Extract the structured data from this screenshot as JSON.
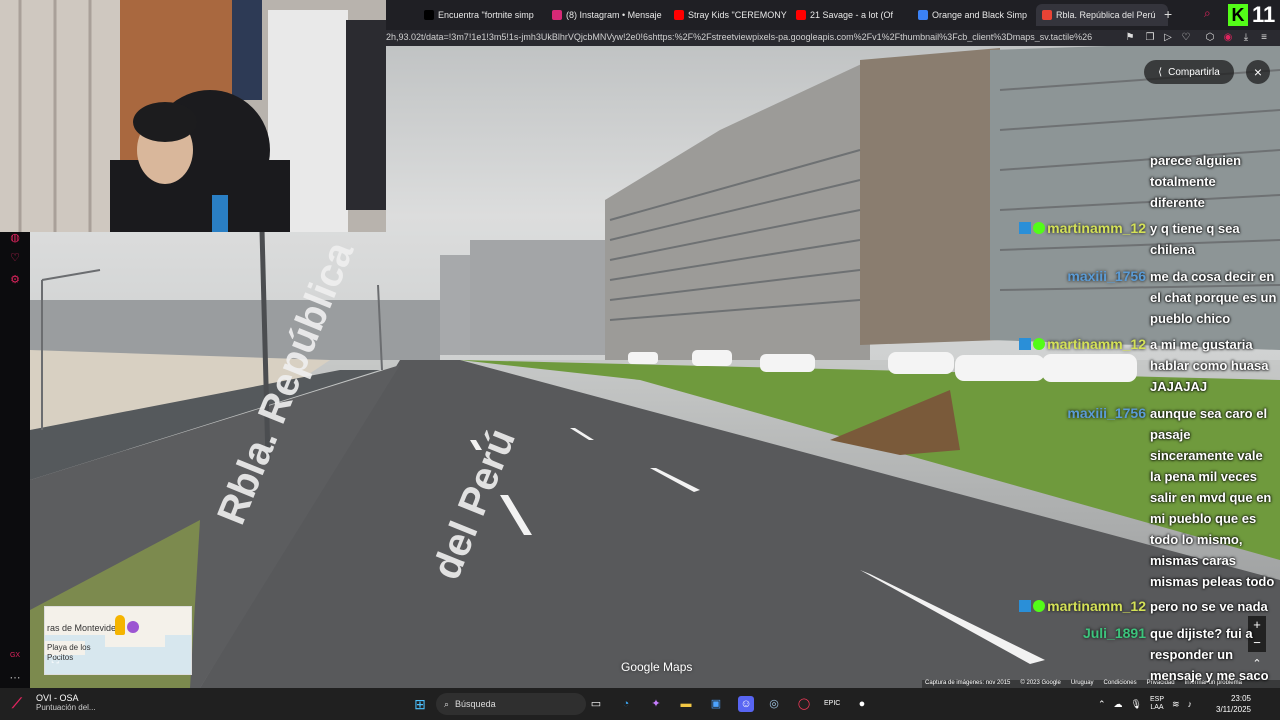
{
  "browser": {
    "tabs": [
      {
        "label": "Encuentra \"fortnite simp",
        "icon": "tiktok-icon",
        "color": "#000000"
      },
      {
        "label": "(8) Instagram • Mensaje",
        "icon": "instagram-icon",
        "color": "#d62976"
      },
      {
        "label": "Stray Kids \"CEREMONY",
        "icon": "youtube-icon",
        "color": "#ff0000"
      },
      {
        "label": "21 Savage - a lot (Of",
        "icon": "youtube-icon",
        "color": "#ff0000"
      },
      {
        "label": "Orange and Black Simp",
        "icon": "canva-icon",
        "color": "#3b82f6"
      },
      {
        "label": "Rbla. República del Perú",
        "icon": "maps-icon",
        "color": "#ea4335",
        "active": true
      }
    ],
    "new_tab": "+",
    "url": "2h,93.02t/data=!3m7!1e1!3m5!1s-jmh3UkBlhrVQjcbMNVyw!2e0!6shttps:%2F%2Fstreetviewpixels-pa.googleapis.com%2Fv1%2Fthumbnail%3Fcb_client%3Dmaps_sv.tactile%26"
  },
  "kick": {
    "logo": "K",
    "count": "11"
  },
  "streetview": {
    "share_label": "Compartirla",
    "close": "×",
    "street_name_line1": "Rbla. República",
    "street_name_line2": "del Perú",
    "minimap_city": "ras de Montevideo",
    "minimap_sub": "Playa de los Pocitos",
    "watermark": "Google Maps",
    "footer": [
      "Captura de imágenes: nov 2015",
      "© 2023 Google",
      "Uruguay",
      "Condiciones",
      "Privacidad",
      "Informar un problema"
    ],
    "zoom_in": "+",
    "zoom_out": "−"
  },
  "chat": [
    {
      "user": "",
      "text": "parece alguien\ntotalmente\ndiferente"
    },
    {
      "user": "martinamm_12",
      "user_color": "#d4e157",
      "badges": true,
      "text": "y q tiene q sea\nchilena"
    },
    {
      "user": "maxiii_1756",
      "user_color": "#5b9bd5",
      "badges": false,
      "text": "me da cosa decir en\nel chat porque es un\npueblo chico"
    },
    {
      "user": "martinamm_12",
      "user_color": "#d4e157",
      "badges": true,
      "text": "a mi me gustaria\nhablar como huasa\nJAJAJAJ"
    },
    {
      "user": "maxiii_1756",
      "user_color": "#5b9bd5",
      "badges": false,
      "text": "aunque sea caro el\npasaje\nsinceramente vale\nla pena mil veces\nsalir en mvd que en\nmi pueblo que es\ntodo lo mismo,\nmismas caras\nmismas peleas todo"
    },
    {
      "user": "martinamm_12",
      "user_color": "#d4e157",
      "badges": true,
      "text": "pero no se ve nada"
    },
    {
      "user": "Juli_1891",
      "user_color": "#3cc47c",
      "badges": false,
      "text": "que dijiste? fui a\nresponder un\nmensaje y me saco"
    }
  ],
  "taskbar": {
    "notif_title": "OVI - OSA",
    "notif_sub": "Puntuación del...",
    "search_placeholder": "Búsqueda",
    "lang_line1": "ESP",
    "lang_line2": "LAA",
    "time": "23:05",
    "date": "3/11/2025"
  }
}
